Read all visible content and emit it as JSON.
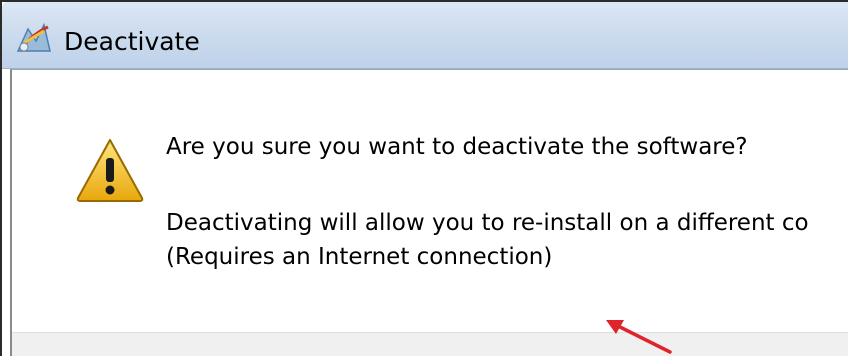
{
  "window": {
    "title": "Deactivate",
    "title_icon": "app-icon-deactivate"
  },
  "dialog": {
    "icon": "warning-icon",
    "main_instruction": "Are you sure you want to deactivate the software?",
    "content_line_1": "Deactivating will allow you to re-install on a different co",
    "content_line_2": "(Requires an Internet connection)"
  },
  "annotation": {
    "type": "arrow",
    "color": "#e0242b"
  },
  "colors": {
    "titlebar": "#cddcee",
    "footer": "#f0f0f0",
    "warning_yellow": "#f2c21b"
  }
}
